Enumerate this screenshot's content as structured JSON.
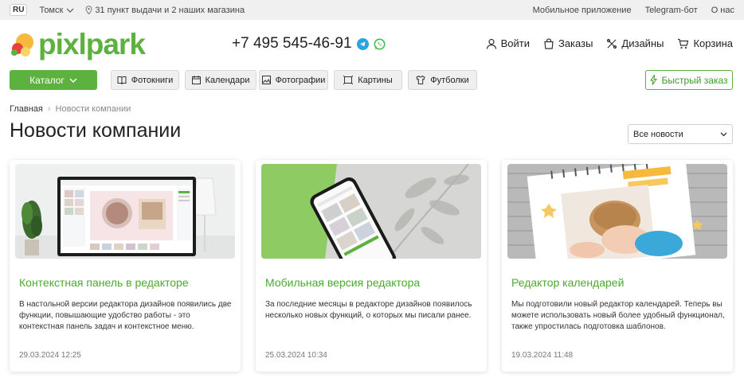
{
  "topbar": {
    "lang": "RU",
    "city": "Томск",
    "pickup": "31 пункт выдачи и 2 наших магазина",
    "links": [
      "Мобильное приложение",
      "Telegram-бот",
      "О нас"
    ]
  },
  "header": {
    "logo_text": "pixlpark",
    "phone": "+7 495 545-46-91",
    "actions": {
      "login": "Войти",
      "orders": "Заказы",
      "designs": "Дизайны",
      "cart": "Корзина"
    }
  },
  "nav": {
    "catalog": "Каталог",
    "categories": [
      "Фотокниги",
      "Календари",
      "Фотографии",
      "Картины",
      "Футболки"
    ],
    "quick_order": "Быстрый заказ"
  },
  "breadcrumb": {
    "home": "Главная",
    "current": "Новости компании"
  },
  "page_title": "Новости компании",
  "filter": {
    "selected": "Все новости"
  },
  "cards": [
    {
      "title": "Контекстная панель в редакторе",
      "text": "В настольной версии редактора дизайнов появились две функции, повышающие удобство работы - это контекстная панель задач и контекстное меню.",
      "date": "29.03.2024 12:25"
    },
    {
      "title": "Мобильная версия редактора",
      "text": "За последние месяцы в редакторе дизайнов появилось несколько новых функций, о которых мы писали ранее.",
      "date": "25.03.2024 10:34"
    },
    {
      "title": "Редактор календарей",
      "text": "Мы подготовили новый редактор календарей. Теперь вы можете использовать новый более удобный функционал, также упростилась подготовка шаблонов.",
      "date": "19.03.2024 11:48"
    }
  ],
  "colors": {
    "brand_green": "#5db13e",
    "link_green": "#4ea833"
  }
}
